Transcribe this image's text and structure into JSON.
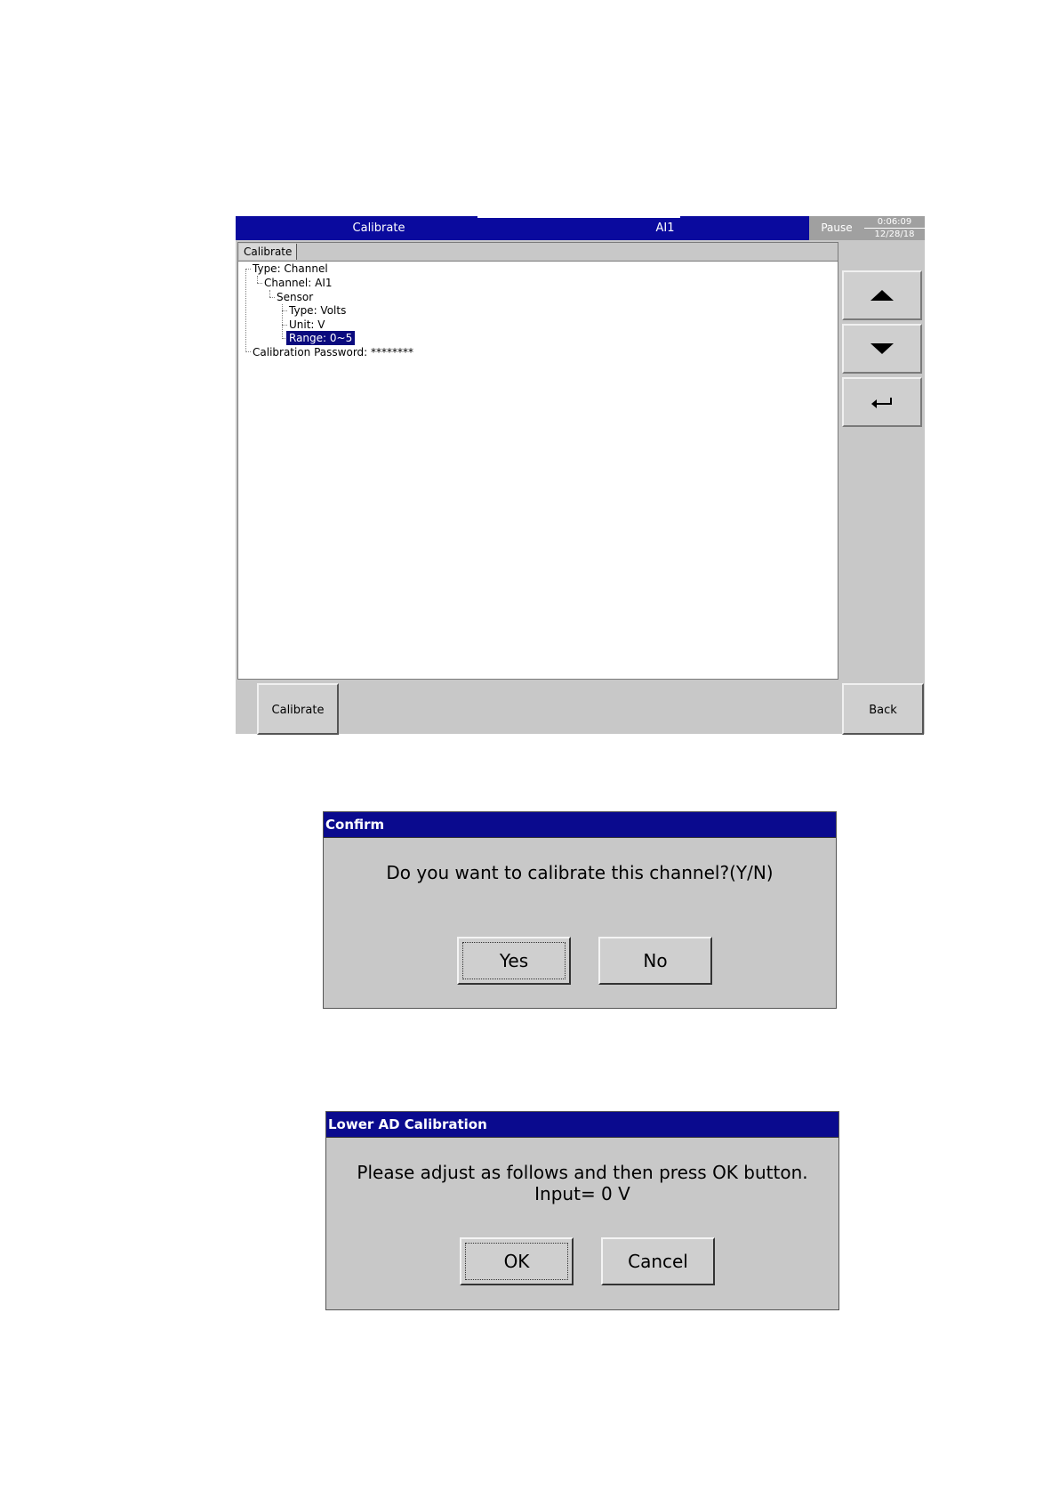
{
  "screen": {
    "title_left": "Calibrate",
    "title_right": "AI1",
    "status": "Pause",
    "clock_time": "0:06:09",
    "clock_date": "12/28/18",
    "tab_label": "Calibrate",
    "tree": [
      "Type: Channel",
      "Channel: AI1",
      "Sensor",
      "Type: Volts",
      "Unit: V",
      "Range: 0~5",
      "Calibration Password: ********"
    ],
    "side_buttons": [
      "arrow-up-icon",
      "arrow-down-icon",
      "enter-icon"
    ],
    "bottom_left_button": "Calibrate",
    "bottom_right_button": "Back"
  },
  "confirm_dialog": {
    "title": "Confirm",
    "message": "Do you want to calibrate this channel?(Y/N)",
    "yes_label": "Yes",
    "no_label": "No"
  },
  "lower_ad_dialog": {
    "title": "Lower AD Calibration",
    "message_line1": "Please adjust as follows and then press OK button.",
    "message_line2": "Input= 0 V",
    "ok_label": "OK",
    "cancel_label": "Cancel"
  },
  "colors": {
    "titlebar": "#0a0a9e",
    "panel_bg": "#c8c8c8",
    "selection": "#0a0a7e"
  }
}
